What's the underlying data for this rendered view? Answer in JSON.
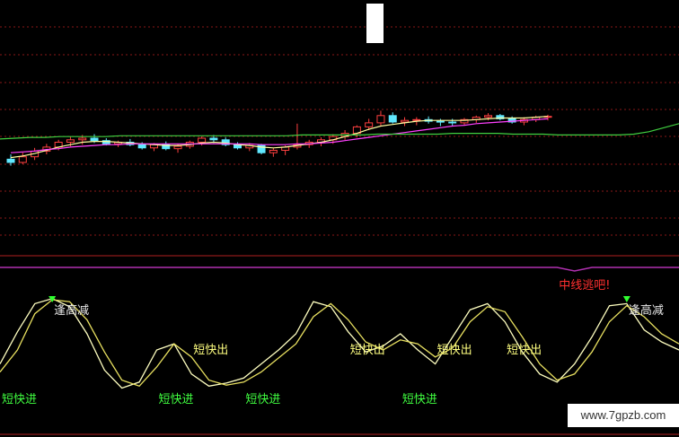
{
  "chart_data": [
    {
      "type": "candlestick",
      "title": "",
      "xlabel": "",
      "ylabel": "",
      "ylim": [
        0,
        100
      ],
      "grid": true,
      "candles": [
        {
          "o": 14,
          "h": 20,
          "l": 6,
          "c": 10,
          "up": false
        },
        {
          "o": 10,
          "h": 22,
          "l": 8,
          "c": 17,
          "up": true
        },
        {
          "o": 17,
          "h": 28,
          "l": 13,
          "c": 24,
          "up": true
        },
        {
          "o": 24,
          "h": 33,
          "l": 20,
          "c": 29,
          "up": true
        },
        {
          "o": 29,
          "h": 38,
          "l": 25,
          "c": 35,
          "up": true
        },
        {
          "o": 35,
          "h": 42,
          "l": 30,
          "c": 38,
          "up": true
        },
        {
          "o": 38,
          "h": 44,
          "l": 32,
          "c": 40,
          "up": true
        },
        {
          "o": 40,
          "h": 45,
          "l": 34,
          "c": 37,
          "up": false
        },
        {
          "o": 37,
          "h": 40,
          "l": 31,
          "c": 33,
          "up": false
        },
        {
          "o": 33,
          "h": 37,
          "l": 29,
          "c": 35,
          "up": true
        },
        {
          "o": 35,
          "h": 39,
          "l": 30,
          "c": 32,
          "up": false
        },
        {
          "o": 32,
          "h": 35,
          "l": 26,
          "c": 28,
          "up": false
        },
        {
          "o": 28,
          "h": 34,
          "l": 24,
          "c": 32,
          "up": true
        },
        {
          "o": 32,
          "h": 36,
          "l": 25,
          "c": 27,
          "up": false
        },
        {
          "o": 27,
          "h": 33,
          "l": 22,
          "c": 30,
          "up": true
        },
        {
          "o": 30,
          "h": 37,
          "l": 27,
          "c": 35,
          "up": true
        },
        {
          "o": 35,
          "h": 42,
          "l": 31,
          "c": 40,
          "up": true
        },
        {
          "o": 40,
          "h": 44,
          "l": 34,
          "c": 38,
          "up": false
        },
        {
          "o": 38,
          "h": 41,
          "l": 30,
          "c": 32,
          "up": false
        },
        {
          "o": 32,
          "h": 35,
          "l": 26,
          "c": 28,
          "up": false
        },
        {
          "o": 28,
          "h": 34,
          "l": 24,
          "c": 31,
          "up": true
        },
        {
          "o": 31,
          "h": 33,
          "l": 20,
          "c": 22,
          "up": false
        },
        {
          "o": 22,
          "h": 28,
          "l": 17,
          "c": 25,
          "up": true
        },
        {
          "o": 25,
          "h": 31,
          "l": 19,
          "c": 29,
          "up": true
        },
        {
          "o": 29,
          "h": 58,
          "l": 26,
          "c": 32,
          "up": true
        },
        {
          "o": 32,
          "h": 38,
          "l": 28,
          "c": 35,
          "up": true
        },
        {
          "o": 35,
          "h": 41,
          "l": 30,
          "c": 38,
          "up": true
        },
        {
          "o": 38,
          "h": 45,
          "l": 33,
          "c": 42,
          "up": true
        },
        {
          "o": 42,
          "h": 50,
          "l": 38,
          "c": 46,
          "up": true
        },
        {
          "o": 46,
          "h": 56,
          "l": 41,
          "c": 54,
          "up": true
        },
        {
          "o": 54,
          "h": 64,
          "l": 50,
          "c": 59,
          "up": true
        },
        {
          "o": 59,
          "h": 74,
          "l": 55,
          "c": 68,
          "up": true
        },
        {
          "o": 68,
          "h": 72,
          "l": 58,
          "c": 60,
          "up": false
        },
        {
          "o": 60,
          "h": 66,
          "l": 55,
          "c": 62,
          "up": true
        },
        {
          "o": 62,
          "h": 66,
          "l": 56,
          "c": 63,
          "up": true
        },
        {
          "o": 63,
          "h": 67,
          "l": 58,
          "c": 61,
          "up": false
        },
        {
          "o": 61,
          "h": 64,
          "l": 55,
          "c": 60,
          "up": false
        },
        {
          "o": 60,
          "h": 64,
          "l": 55,
          "c": 59,
          "up": false
        },
        {
          "o": 59,
          "h": 65,
          "l": 56,
          "c": 63,
          "up": true
        },
        {
          "o": 63,
          "h": 68,
          "l": 59,
          "c": 66,
          "up": true
        },
        {
          "o": 66,
          "h": 71,
          "l": 62,
          "c": 68,
          "up": true
        },
        {
          "o": 68,
          "h": 70,
          "l": 62,
          "c": 64,
          "up": false
        },
        {
          "o": 64,
          "h": 67,
          "l": 58,
          "c": 60,
          "up": false
        },
        {
          "o": 60,
          "h": 66,
          "l": 56,
          "c": 63,
          "up": true
        },
        {
          "o": 63,
          "h": 68,
          "l": 60,
          "c": 66,
          "up": true
        },
        {
          "o": 66,
          "h": 69,
          "l": 62,
          "c": 67,
          "up": true
        }
      ],
      "series": [
        {
          "color": "#ffffa0",
          "values": [
            16,
            18,
            21,
            25,
            29,
            32,
            35,
            36,
            36,
            35,
            34,
            33,
            32,
            31,
            31,
            32,
            34,
            35,
            34,
            32,
            31,
            29,
            28,
            29,
            31,
            33,
            35,
            38,
            42,
            46,
            51,
            55,
            57,
            59,
            61,
            62,
            62,
            62,
            62,
            63,
            64,
            65,
            65,
            65,
            66,
            67
          ]
        },
        {
          "color": "#ff40ff",
          "values": [
            22,
            23,
            24,
            26,
            27,
            29,
            30,
            31,
            32,
            32,
            33,
            33,
            33,
            33,
            33,
            33,
            33,
            33,
            33,
            33,
            33,
            32,
            32,
            32,
            33,
            33,
            34,
            35,
            37,
            39,
            41,
            43,
            45,
            47,
            49,
            51,
            53,
            55,
            56,
            58,
            59,
            60,
            61,
            62,
            63,
            64
          ]
        },
        {
          "color": "#40d040",
          "values": [
            39,
            40,
            41,
            41,
            42,
            42,
            42,
            42,
            43,
            43,
            43,
            43,
            43,
            43,
            43,
            43,
            43,
            43,
            43,
            43,
            44,
            44,
            44,
            44,
            44,
            45,
            45,
            45,
            45,
            45,
            46,
            46,
            46,
            46,
            45,
            45,
            45,
            44,
            44,
            44,
            44,
            44,
            45,
            48,
            53,
            58
          ]
        }
      ]
    },
    {
      "type": "line",
      "title": "",
      "xlabel": "",
      "ylabel": "",
      "ylim": [
        0,
        100
      ],
      "grid": false,
      "series": [
        {
          "color": "#ffffc0",
          "values": [
            28,
            60,
            88,
            93,
            85,
            58,
            22,
            4,
            10,
            42,
            48,
            18,
            6,
            9,
            14,
            28,
            42,
            58,
            90,
            85,
            60,
            40,
            46,
            58,
            42,
            28,
            55,
            82,
            88,
            70,
            40,
            18,
            10,
            28,
            55,
            86,
            88,
            62,
            50,
            42
          ]
        },
        {
          "color": "#e8e060",
          "values": [
            20,
            42,
            78,
            92,
            90,
            72,
            40,
            12,
            6,
            25,
            48,
            35,
            12,
            7,
            10,
            20,
            34,
            48,
            75,
            88,
            72,
            50,
            42,
            52,
            48,
            35,
            44,
            70,
            85,
            80,
            55,
            28,
            12,
            18,
            40,
            70,
            86,
            75,
            58,
            48
          ]
        },
        {
          "color": "#b030b0",
          "values": [
            100,
            100,
            100,
            100,
            100,
            100,
            100,
            100,
            100,
            100,
            100,
            100,
            100,
            100,
            100,
            100,
            100,
            100,
            100,
            100,
            100,
            100,
            100,
            100,
            100,
            100,
            100,
            100,
            100,
            100,
            100,
            100,
            100,
            80,
            100,
            100,
            100,
            100,
            100,
            100
          ]
        }
      ],
      "annotations": [
        {
          "text": "逢高减",
          "color": "#e8e8e8",
          "series_index": 3
        },
        {
          "text": "短快出",
          "color": "#ffff80",
          "series_index": 11
        },
        {
          "text": "短快出",
          "color": "#ffff80",
          "series_index": 20
        },
        {
          "text": "短快出",
          "color": "#ffff80",
          "series_index": 25
        },
        {
          "text": "短快出",
          "color": "#ffff80",
          "series_index": 29
        },
        {
          "text": "逢高减",
          "color": "#e8e8e8",
          "series_index": 36
        },
        {
          "text": "短快进",
          "color": "#40ff40",
          "series_index": 0
        },
        {
          "text": "短快进",
          "color": "#40ff40",
          "series_index": 9
        },
        {
          "text": "短快进",
          "color": "#40ff40",
          "series_index": 14
        },
        {
          "text": "短快进",
          "color": "#40ff40",
          "series_index": 23
        },
        {
          "text": "中线逃吧!",
          "color": "#ff3030",
          "series_index": 32
        }
      ]
    }
  ],
  "watermark": "www.7gpzb.com"
}
